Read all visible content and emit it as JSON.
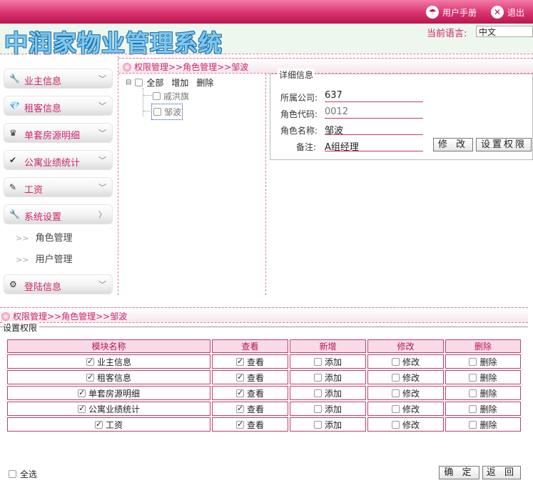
{
  "topbar": {
    "manual": "用户手册",
    "logout": "退出"
  },
  "header": {
    "app_title": "中润家物业管理系统",
    "lang_label": "当前语言:",
    "lang_value": "中文"
  },
  "sidebar": {
    "items": [
      {
        "label": "业主信息",
        "icon": "wrench-icon",
        "glyph": "🔧"
      },
      {
        "label": "租客信息",
        "icon": "gem-icon",
        "glyph": "💎"
      },
      {
        "label": "单套房源明细",
        "icon": "crown-icon",
        "glyph": "♛"
      },
      {
        "label": "公寓业绩统计",
        "icon": "check-icon",
        "glyph": "✔"
      },
      {
        "label": "工资",
        "icon": "pencil-icon",
        "glyph": "✎"
      },
      {
        "label": "系统设置",
        "icon": "wrench-icon",
        "glyph": "🔧"
      },
      {
        "label": "登陆信息",
        "icon": "gear-icon",
        "glyph": "⚙"
      }
    ],
    "subitems": [
      "角色管理",
      "用户管理"
    ]
  },
  "breadcrumb": {
    "text": "权限管理>>角色管理>>邹波"
  },
  "tree": {
    "root_label": "全部",
    "add_label": "增加",
    "delete_label": "删除",
    "nodes": [
      "戚洪旗",
      "邹波"
    ]
  },
  "detail": {
    "legend": "详细信息",
    "company_label": "所属公司:",
    "company_value": "637",
    "code_label": "角色代码:",
    "code_value": "0012",
    "name_label": "角色名称:",
    "name_value": "邹波",
    "remark_label": "备注:",
    "remark_value": "A组经理",
    "edit_button": "修 改",
    "perm_button": "设置权限"
  },
  "bottom": {
    "breadcrumb": "权限管理>>角色管理>>邹波",
    "section_title": "设置权限",
    "headers": [
      "模块名称",
      "查看",
      "新增",
      "修改",
      "删除"
    ],
    "rows": [
      {
        "module": "业主信息",
        "view": "查看",
        "add": "添加",
        "edit": "修改",
        "del": "删除"
      },
      {
        "module": "租客信息",
        "view": "查看",
        "add": "添加",
        "edit": "修改",
        "del": "删除"
      },
      {
        "module": "单套房源明细",
        "view": "查看",
        "add": "添加",
        "edit": "修改",
        "del": "删除"
      },
      {
        "module": "公寓业绩统计",
        "view": "查看",
        "add": "添加",
        "edit": "修改",
        "del": "删除"
      },
      {
        "module": "工资",
        "view": "查看",
        "add": "添加",
        "edit": "修改",
        "del": "删除"
      }
    ],
    "select_all": "全选",
    "confirm_button": "确 定",
    "back_button": "返 回"
  },
  "colors": {
    "brand_pink": "#d0246a",
    "title_blue": "#7ec8ef"
  }
}
